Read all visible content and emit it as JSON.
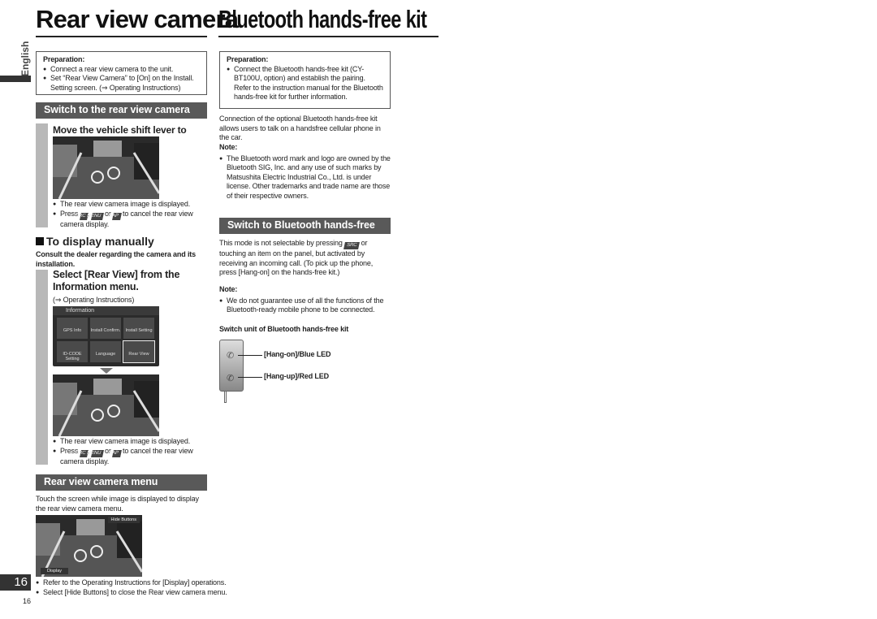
{
  "left": {
    "title": "Rear view camera",
    "language_tab": "English",
    "preparation": {
      "label": "Preparation:",
      "items": [
        "Connect a rear view camera to the unit.",
        "Set “Rear View Camera” to [On] on the Install. Setting screen. (⇒ Operating Instructions)"
      ]
    },
    "section1": {
      "header": "Switch to the rear view camera screen",
      "step": "Move the vehicle shift lever to reverse.",
      "bullet1": "The rear view camera image is displayed.",
      "press": "Press",
      "or": "or",
      "cancel": "to cancel the rear view camera display."
    },
    "keys": {
      "src": "SRC",
      "menu": "MENU",
      "map": "MAP"
    },
    "manual": {
      "heading": "To display manually",
      "consult": "Consult the dealer regarding the camera and its installation.",
      "step": "Select [Rear View] from the Information menu.",
      "ref": "(⇒ Operating Instructions)",
      "bullet1": "The rear view camera image is displayed."
    },
    "info_menu": {
      "title": "Information",
      "buttons": [
        "GPS Info",
        "Install Confirm.",
        "Install Setting",
        "ID-CODE Setting",
        "Language",
        "Rear View"
      ]
    },
    "section2": {
      "header": "Rear view camera menu",
      "text": "Touch the screen while image is displayed to display the rear view camera menu.",
      "hide_button": "Hide Buttons",
      "display_button": "Display",
      "bullets": [
        "Refer to the Operating Instructions for [Display] operations.",
        "Select [Hide Buttons] to close the Rear view camera menu."
      ]
    },
    "page_tab": "16",
    "page_number": "16"
  },
  "right": {
    "title": "Bluetooth hands-free kit",
    "preparation": {
      "label": "Preparation:",
      "item": "Connect the Bluetooth hands-free kit (CY-BT100U, option) and establish the pairing. Refer to the instruction manual for the Bluetooth hands-free kit for further information."
    },
    "intro": "Connection of the optional Bluetooth hands-free kit allows users to talk on a handsfree cellular phone in the car.",
    "note1": {
      "label": "Note:",
      "item": "The Bluetooth word mark and logo are owned by the Bluetooth SIG, Inc. and any use of such marks by Matsushita Electric Industrial Co., Ltd. is under license. Other trademarks and trade name are those of their respective owners."
    },
    "section": {
      "header": "Switch to Bluetooth hands-free",
      "text_a": "This mode is not selectable by pressing",
      "text_b": "or touching an item on the panel, but activated by receiving an incoming call. (To pick up the phone, press [Hang-on] on the hands-free kit.)"
    },
    "note2": {
      "label": "Note:",
      "item": "We do not guarantee use of all the functions of the Bluetooth-ready mobile phone to be connected."
    },
    "switch_unit": {
      "title": "Switch unit of Bluetooth hands-free kit",
      "hang_on": "[Hang-on]/Blue LED",
      "hang_up": "[Hang-up]/Red LED"
    }
  }
}
